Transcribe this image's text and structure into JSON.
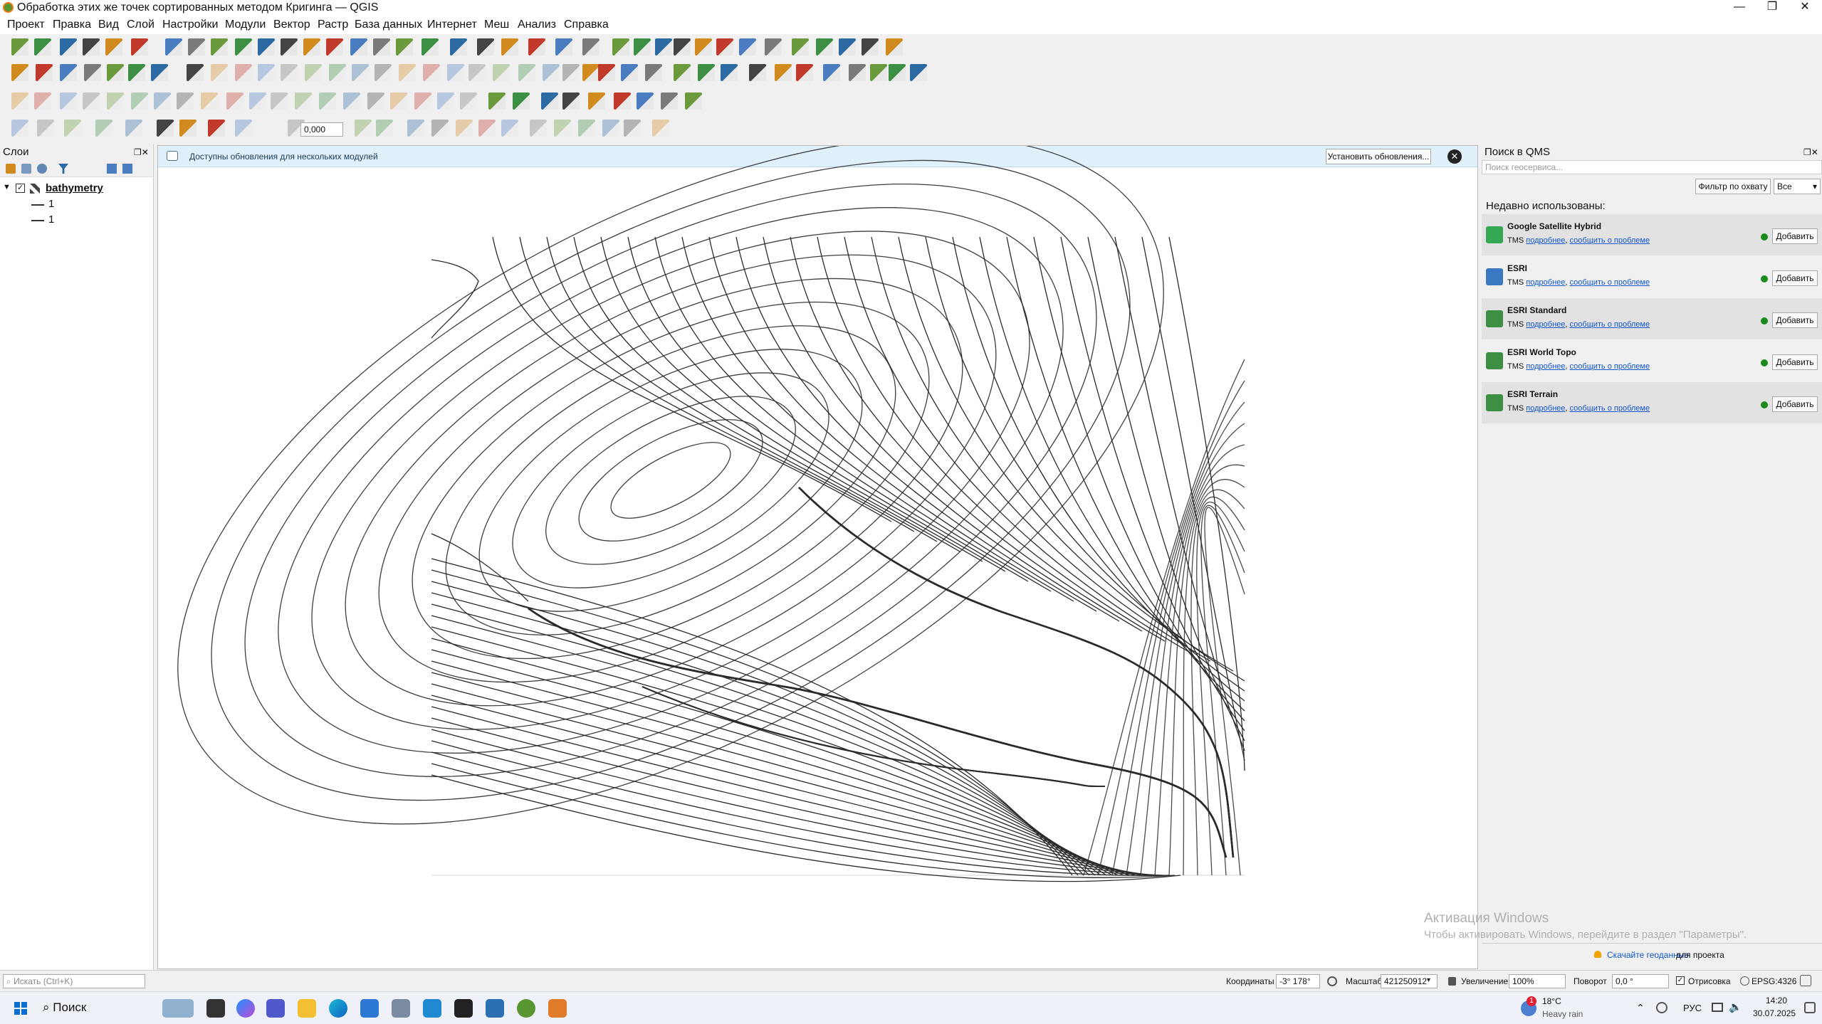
{
  "window": {
    "title": "Обработка этих же точек сортированных методом Кригинга — QGIS",
    "controls": [
      "—",
      "❐",
      "✕"
    ]
  },
  "menu": [
    "Проект",
    "Правка",
    "Вид",
    "Слой",
    "Настройки",
    "Модули",
    "Вектор",
    "Растр",
    "База данных",
    "Интернет",
    "Меш",
    "Анализ",
    "Справка"
  ],
  "toolbar": {
    "value_field": "0,000"
  },
  "layers_panel": {
    "title": "Слои",
    "tree": [
      {
        "label": "bathymetry",
        "checked": true,
        "expanded": true
      },
      {
        "label": "1"
      },
      {
        "label": "1"
      }
    ]
  },
  "message_bar": {
    "text": "Доступны обновления для нескольких модулей",
    "button": "Установить обновления..."
  },
  "qms_panel": {
    "title": "Поиск в QMS",
    "search_placeholder": "Поиск геосервиса...",
    "filter_button": "Фильтр по охвату",
    "filter_select": "Все",
    "recent_heading": "Недавно использованы:",
    "services": [
      {
        "name": "Google Satellite Hybrid",
        "type": "TMS",
        "link1": "подробнее",
        "link2": "сообщить о проблеме",
        "add": "Добавить",
        "icon": "google-maps-icon"
      },
      {
        "name": "ESRI",
        "type": "TMS",
        "link1": "подробнее",
        "link2": "сообщить о проблеме",
        "add": "Добавить",
        "icon": "map-book-icon"
      },
      {
        "name": "ESRI Standard",
        "type": "TMS",
        "link1": "подробнее",
        "link2": "сообщить о проблеме",
        "add": "Добавить",
        "icon": "landscape-icon"
      },
      {
        "name": "ESRI World Topo",
        "type": "TMS",
        "link1": "подробнее",
        "link2": "сообщить о проблеме",
        "add": "Добавить",
        "icon": "landscape-icon"
      },
      {
        "name": "ESRI Terrain",
        "type": "TMS",
        "link1": "подробнее",
        "link2": "сообщить о проблеме",
        "add": "Добавить",
        "icon": "landscape-icon"
      }
    ],
    "footer_link": "Скачайте геоданные",
    "footer_text": "для проекта"
  },
  "watermark": {
    "title": "Активация Windows",
    "text": "Чтобы активировать Windows, перейдите в раздел \"Параметры\"."
  },
  "statusbar": {
    "locator_placeholder": "Искать (Ctrl+K)",
    "coord_label": "Координаты",
    "coord_value": "-3° 178°",
    "scale_label": "Масштаб",
    "scale_value": "421250912",
    "magnifier_label": "Увеличение",
    "magnifier_value": "100%",
    "rotation_label": "Поворот",
    "rotation_value": "0,0 °",
    "render_label": "Отрисовка",
    "crs": "EPSG:4326"
  },
  "taskbar": {
    "search": "Поиск",
    "weather_temp": "18°C",
    "weather_text": "Heavy rain",
    "lang": "РУС",
    "time": "14:20",
    "date": "30.07.2025",
    "notification_count": "1"
  }
}
